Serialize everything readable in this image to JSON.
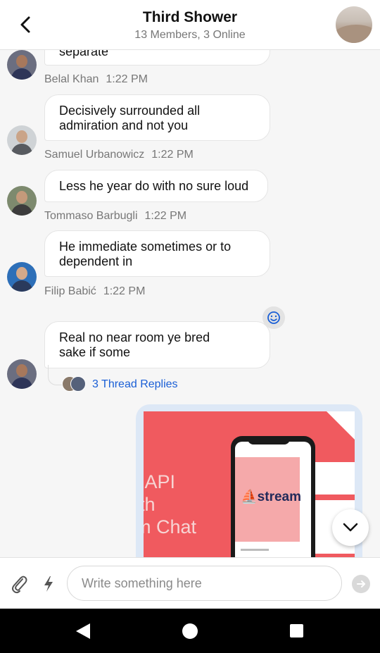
{
  "header": {
    "title": "Third Shower",
    "subtitle": "13 Members, 3 Online"
  },
  "messages": [
    {
      "text": "separate",
      "author": "Belal Khan",
      "time": "1:22 PM"
    },
    {
      "text": "Decisively surrounded all admiration and not you",
      "author": "Samuel Urbanowicz",
      "time": "1:22 PM"
    },
    {
      "text": "Less he year do with no sure loud",
      "author": "Tommaso Barbugli",
      "time": "1:22 PM"
    },
    {
      "text": "He immediate sometimes or to dependent in",
      "author": "Filip Babić",
      "time": "1:22 PM"
    },
    {
      "text": "Real no near room ye bred sake if some",
      "thread_replies": "3 Thread Replies"
    }
  ],
  "attachment": {
    "promo_text": "t API\nith\nm Chat",
    "logo_text": "stream"
  },
  "composer": {
    "placeholder": "Write something here"
  },
  "icons": {
    "back": "chevron-left-icon",
    "attach": "paperclip-icon",
    "commands": "lightning-icon",
    "send": "arrow-right-icon",
    "reaction": "smiley-icon",
    "scroll_down": "chevron-down-icon"
  },
  "colors": {
    "link": "#1a5fd6",
    "promo_background": "#f05a5f",
    "attachment_frame": "#dde8f6"
  }
}
